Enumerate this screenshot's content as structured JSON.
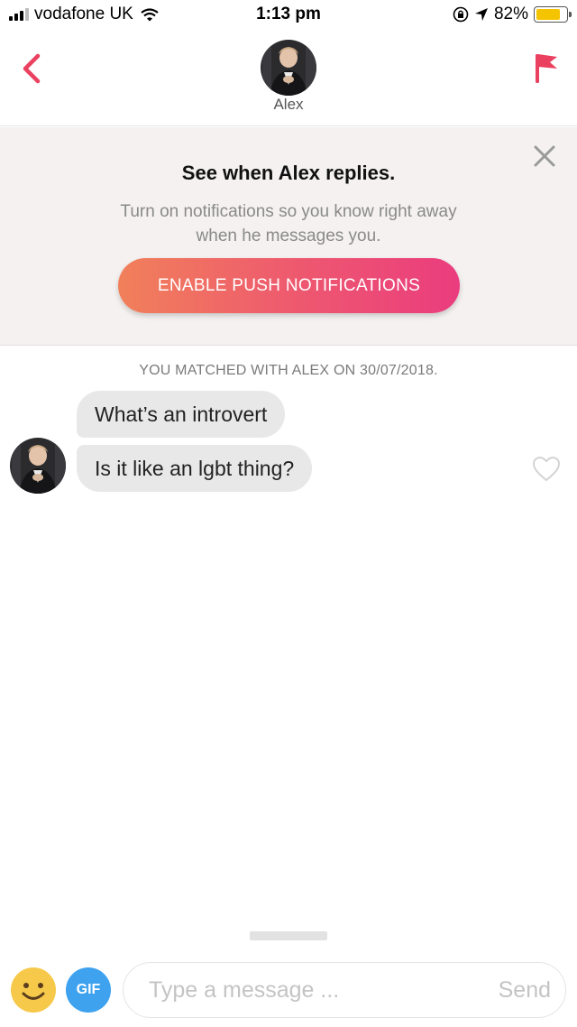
{
  "status_bar": {
    "carrier": "vodafone UK",
    "time": "1:13 pm",
    "battery": "82%",
    "battery_level": 0.82,
    "battery_color": "#f5c400"
  },
  "header": {
    "contact_name": "Alex",
    "back_icon": "chevron-left-icon",
    "report_icon": "flag-icon",
    "accent_color": "#ea4160"
  },
  "banner": {
    "title": "See when Alex replies.",
    "text": "Turn on notifications so you know right away when he messages you.",
    "button_label": "ENABLE PUSH NOTIFICATIONS",
    "close_icon": "close-icon"
  },
  "conversation": {
    "match_note": "YOU MATCHED WITH ALEX ON 30/07/2018.",
    "messages": [
      {
        "text": "What’s an introvert"
      },
      {
        "text": "Is it like an lgbt thing?"
      }
    ]
  },
  "composer": {
    "gif_label": "GIF",
    "placeholder": "Type a message ...",
    "send_label": "Send"
  }
}
